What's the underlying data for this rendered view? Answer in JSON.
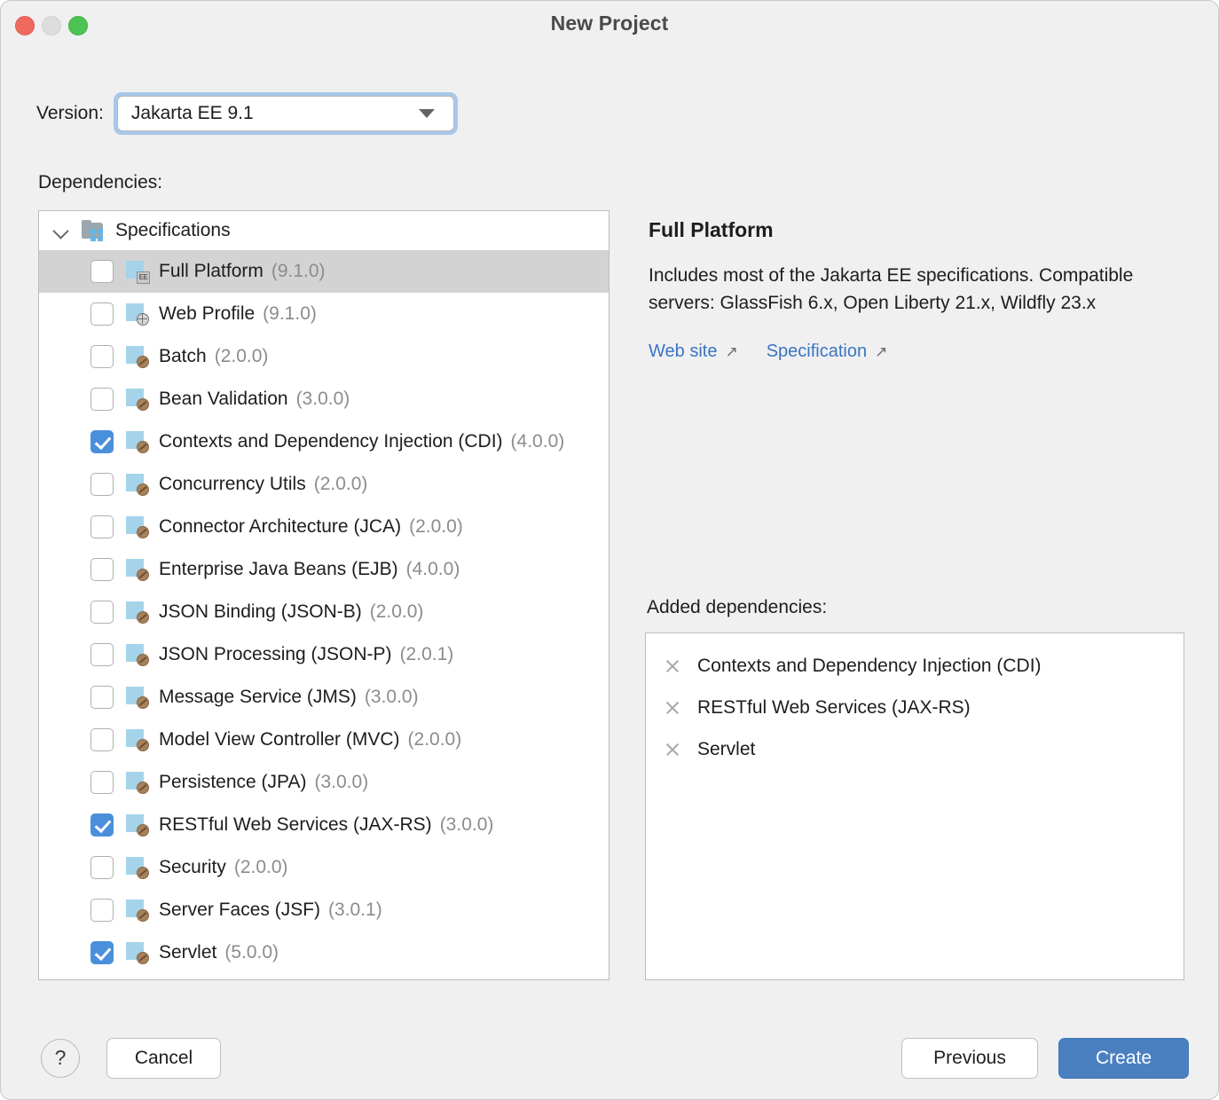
{
  "window": {
    "title": "New Project",
    "traffic_lights": [
      "close-button",
      "minimize-button",
      "maximize-button"
    ]
  },
  "version": {
    "label": "Version:",
    "value": "Jakarta EE 9.1",
    "arrow_icon": "chevron-down-icon"
  },
  "dependencies": {
    "label": "Dependencies:",
    "group": {
      "label": "Specifications",
      "expanded": true,
      "chevron_icon": "chevron-down-icon",
      "folder_icon": "module-group-icon"
    },
    "items": [
      {
        "name": "Full Platform",
        "version": "(9.1.0)",
        "checked": false,
        "selected": true,
        "icon": "full-platform-icon"
      },
      {
        "name": "Web Profile",
        "version": "(9.1.0)",
        "checked": false,
        "selected": false,
        "icon": "web-profile-icon"
      },
      {
        "name": "Batch",
        "version": "(2.0.0)",
        "checked": false,
        "selected": false,
        "icon": "spec-bean-icon"
      },
      {
        "name": "Bean Validation",
        "version": "(3.0.0)",
        "checked": false,
        "selected": false,
        "icon": "spec-bean-icon"
      },
      {
        "name": "Contexts and Dependency Injection (CDI)",
        "version": "(4.0.0)",
        "checked": true,
        "selected": false,
        "icon": "spec-bean-icon"
      },
      {
        "name": "Concurrency Utils",
        "version": "(2.0.0)",
        "checked": false,
        "selected": false,
        "icon": "spec-bean-icon"
      },
      {
        "name": "Connector Architecture (JCA)",
        "version": "(2.0.0)",
        "checked": false,
        "selected": false,
        "icon": "spec-bean-icon"
      },
      {
        "name": "Enterprise Java Beans (EJB)",
        "version": "(4.0.0)",
        "checked": false,
        "selected": false,
        "icon": "spec-bean-icon"
      },
      {
        "name": "JSON Binding (JSON-B)",
        "version": "(2.0.0)",
        "checked": false,
        "selected": false,
        "icon": "spec-bean-icon"
      },
      {
        "name": "JSON Processing (JSON-P)",
        "version": "(2.0.1)",
        "checked": false,
        "selected": false,
        "icon": "spec-bean-icon"
      },
      {
        "name": "Message Service (JMS)",
        "version": "(3.0.0)",
        "checked": false,
        "selected": false,
        "icon": "spec-bean-icon"
      },
      {
        "name": "Model View Controller (MVC)",
        "version": "(2.0.0)",
        "checked": false,
        "selected": false,
        "icon": "spec-bean-icon"
      },
      {
        "name": "Persistence (JPA)",
        "version": "(3.0.0)",
        "checked": false,
        "selected": false,
        "icon": "spec-bean-icon"
      },
      {
        "name": "RESTful Web Services (JAX-RS)",
        "version": "(3.0.0)",
        "checked": true,
        "selected": false,
        "icon": "spec-bean-icon"
      },
      {
        "name": "Security",
        "version": "(2.0.0)",
        "checked": false,
        "selected": false,
        "icon": "spec-bean-icon"
      },
      {
        "name": "Server Faces (JSF)",
        "version": "(3.0.1)",
        "checked": false,
        "selected": false,
        "icon": "spec-bean-icon"
      },
      {
        "name": "Servlet",
        "version": "(5.0.0)",
        "checked": true,
        "selected": false,
        "icon": "spec-bean-icon"
      }
    ]
  },
  "detail": {
    "title": "Full Platform",
    "description": "Includes most of the Jakarta EE specifications. Compatible servers: GlassFish 6.x, Open Liberty 21.x, Wildfly 23.x",
    "links": [
      {
        "label": "Web site",
        "icon": "external-link-icon"
      },
      {
        "label": "Specification",
        "icon": "external-link-icon"
      }
    ]
  },
  "added": {
    "label": "Added dependencies:",
    "items": [
      {
        "name": "Contexts and Dependency Injection (CDI)",
        "remove_icon": "close-icon"
      },
      {
        "name": "RESTful Web Services (JAX-RS)",
        "remove_icon": "close-icon"
      },
      {
        "name": "Servlet",
        "remove_icon": "close-icon"
      }
    ]
  },
  "footer": {
    "help_label": "?",
    "cancel_label": "Cancel",
    "previous_label": "Previous",
    "create_label": "Create"
  },
  "colors": {
    "accent": "#4a80c0",
    "checkbox_checked": "#4a8fdb",
    "link": "#3a74c4",
    "selection": "#d3d3d3",
    "window_bg": "#f0f0f0",
    "panel_bg": "#ffffff"
  }
}
